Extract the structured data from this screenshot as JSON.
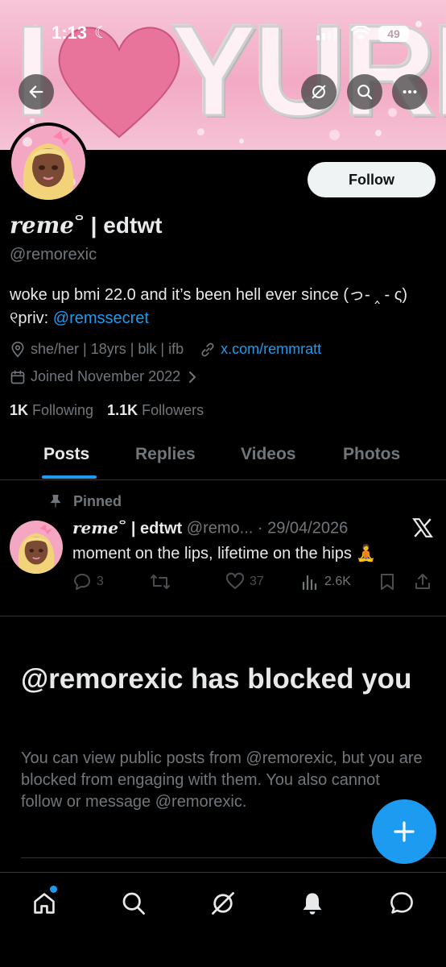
{
  "status_bar": {
    "time": "1:13",
    "battery": "49"
  },
  "banner": {
    "text_i": "I",
    "text_yuri": "YURI"
  },
  "profile": {
    "follow_label": "Follow",
    "name_script": "reme",
    "name_sup": "ᄋ",
    "name_rest": " | edtwt",
    "handle": "@remorexic",
    "bio_text": "woke up bmi 22.0 and it’s been hell ever since (っ- ‸ - ς) ୧priv: ",
    "bio_link": "@remssecret",
    "location": "she/her | 18yrs | blk | ifb",
    "website": "x.com/remmratt",
    "joined": "Joined November 2022",
    "following_count": "1K",
    "following_label": "Following",
    "followers_count": "1.1K",
    "followers_label": "Followers"
  },
  "tabs": [
    "Posts",
    "Replies",
    "Videos",
    "Photos"
  ],
  "pinned_post": {
    "pinned_label": "Pinned",
    "author_script": "reme",
    "author_sup": "ᄋ",
    "author_rest": " | edtwt",
    "handle": "@remo...",
    "date": "· 29/04/2026",
    "text": "moment on the lips, lifetime on the hips 🧘",
    "replies": "3",
    "likes": "37",
    "views": "2.6K"
  },
  "blocked": {
    "title": "@remorexic has blocked you",
    "description": "You can view public posts from @remorexic, but you are blocked from engaging with them. You also cannot follow or message @remorexic."
  },
  "colors": {
    "accent": "#1d9bf0",
    "background": "#000000",
    "muted": "#71767b",
    "banner_pink": "#f2aac5",
    "heart": "#e8749c"
  },
  "icons": {
    "back": "arrow-left-icon",
    "grok": "grok-icon",
    "search": "search-icon",
    "more": "more-icon",
    "home": "home-icon",
    "notifications": "bell-icon",
    "messages": "message-icon",
    "compose": "plus-icon"
  }
}
